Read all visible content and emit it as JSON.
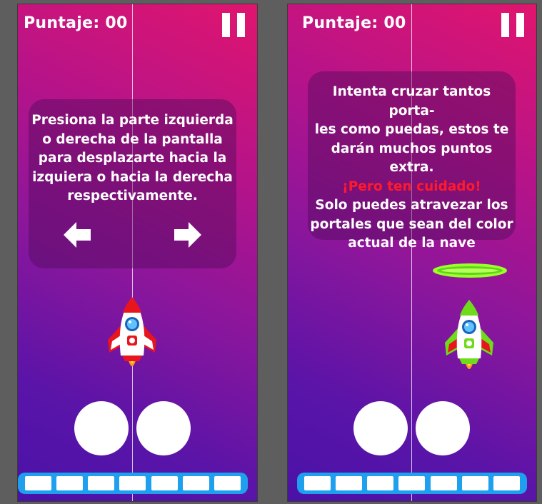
{
  "colors": {
    "background": "#5e5e5e",
    "gradient_top": "#e0156e",
    "gradient_bottom": "#4a12a8",
    "energy_bar": "#1ea0ee",
    "warning_text": "#ff1a2b",
    "portal": "#9bff2a"
  },
  "left_screen": {
    "score_text": "Puntaje: 00",
    "instructions": [
      "Presiona la parte izquierda",
      "o derecha de la pantalla",
      "para desplazarte hacia la",
      "izquiera o hacia la derecha",
      "respectivamente."
    ],
    "left_arrow_icon": "left-arrow-icon",
    "right_arrow_icon": "right-arrow-icon",
    "ship_color": "red",
    "action_buttons": 2,
    "energy_segments": 7
  },
  "right_screen": {
    "score_text": "Puntaje: 00",
    "instructions_lines": [
      "Intenta cruzar tantos porta-",
      "les como puedas, estos te",
      "darán muchos puntos extra."
    ],
    "warning": "¡Pero ten cuidado!",
    "instructions_lines_2": [
      "Solo puedes atravezar los",
      "portales que sean del color",
      "actual de la nave"
    ],
    "portal_color": "green",
    "ship_color": "green",
    "action_buttons": 2,
    "energy_segments": 7
  }
}
